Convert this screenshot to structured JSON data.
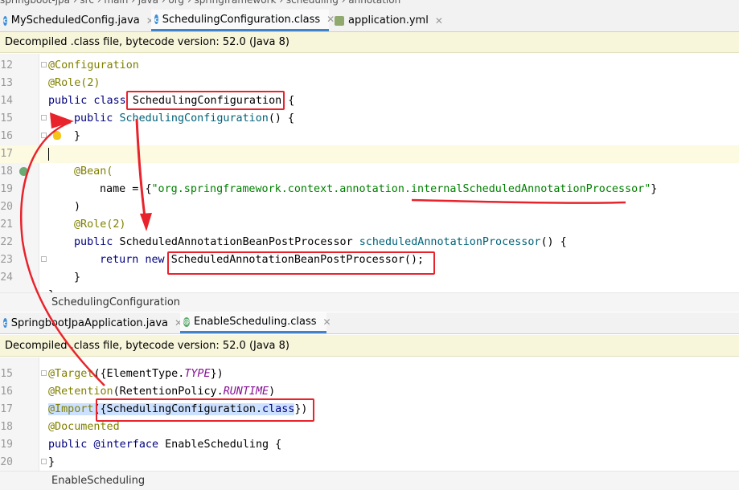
{
  "top_pane": {
    "tabs": [
      {
        "label": "MyScheduledConfig.java",
        "icon": "class-icon"
      },
      {
        "label": "SchedulingConfiguration.class",
        "icon": "class-icon"
      },
      {
        "label": "application.yml",
        "icon": "yml-icon"
      }
    ],
    "banner": "Decompiled .class file, bytecode version: 52.0 (Java 8)",
    "lines": [
      {
        "n": "12"
      },
      {
        "n": "13"
      },
      {
        "n": "14"
      },
      {
        "n": "15"
      },
      {
        "n": "16"
      },
      {
        "n": "17"
      },
      {
        "n": "18"
      },
      {
        "n": "19"
      },
      {
        "n": "20"
      },
      {
        "n": "21"
      },
      {
        "n": "22"
      },
      {
        "n": "23"
      },
      {
        "n": "24"
      }
    ],
    "code": {
      "l12": "@Configuration",
      "l13": "@Role(2)",
      "l14_kw": "public class ",
      "l14_name": "SchedulingConfiguration",
      "l14_end": " {",
      "l15_kw": "public ",
      "l15_name": "SchedulingConfiguration",
      "l15_end": "() {",
      "l16": "}",
      "l18": "@Bean(",
      "l19_a": "name = ",
      "l19_b": "{",
      "l19_str": "\"org.springframework.context.annotation.internalScheduledAnnotationProcessor\"",
      "l19_end": "}",
      "l20": ")",
      "l21": "@Role(2)",
      "l22_kw": "public ",
      "l22_type": "ScheduledAnnotationBeanPostProcessor ",
      "l22_fn": "scheduledAnnotationProcessor",
      "l22_end": "() {",
      "l23_kw": "return new ",
      "l23_rest": "ScheduledAnnotationBeanPostProcessor();",
      "l24": "}",
      "l25": "}"
    },
    "status": "SchedulingConfiguration"
  },
  "bottom_pane": {
    "tabs": [
      {
        "label": "SpringbootJpaApplication.java",
        "icon": "class-icon"
      },
      {
        "label": "EnableScheduling.class",
        "icon": "annotation-icon"
      }
    ],
    "banner": "Decompiled .class file, bytecode version: 52.0 (Java 8)",
    "lines": [
      {
        "n": "15"
      },
      {
        "n": "16"
      },
      {
        "n": "17"
      },
      {
        "n": "18"
      },
      {
        "n": "19"
      },
      {
        "n": "20"
      }
    ],
    "code": {
      "l15_a": "@Target",
      "l15_b": "({ElementType.",
      "l15_c": "TYPE",
      "l15_d": "})",
      "l16_a": "@Retention",
      "l16_b": "(RetentionPolicy.",
      "l16_c": "RUNTIME",
      "l16_d": ")",
      "l17_a": "@Import",
      "l17_b": "({SchedulingConfiguration.",
      "l17_c": "class",
      "l17_d": "})",
      "l18": "@Documented",
      "l19_a": "public ",
      "l19_b": "@interface ",
      "l19_c": "EnableScheduling",
      "l19_d": " {",
      "l20": "}"
    },
    "status": "EnableScheduling"
  },
  "colors": {
    "annotation_red": "#e8232b",
    "keyword": "#000080",
    "annotation": "#808000",
    "string": "#008000",
    "tab_accent": "#4083c9"
  }
}
